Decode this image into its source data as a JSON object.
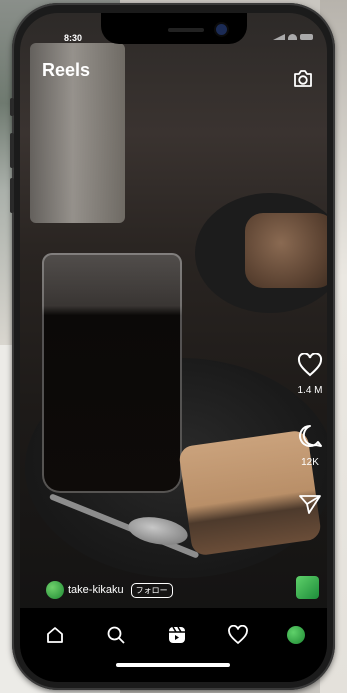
{
  "status_bar": {
    "time": "8:30"
  },
  "header": {
    "title": "Reels",
    "camera_icon": "camera-icon"
  },
  "actions": {
    "like": {
      "icon": "heart-icon",
      "count": "1.4 M"
    },
    "comment": {
      "icon": "comment-icon",
      "count": "12K"
    },
    "share": {
      "icon": "send-icon"
    }
  },
  "post": {
    "username": "take-kikaku",
    "follow_label": "フォロー"
  },
  "nav": {
    "items": [
      "home-icon",
      "search-icon",
      "reels-icon",
      "heart-icon",
      "profile-avatar"
    ]
  },
  "colors": {
    "accent_green": "#2aa84a",
    "background": "#000000",
    "text": "#ffffff"
  }
}
